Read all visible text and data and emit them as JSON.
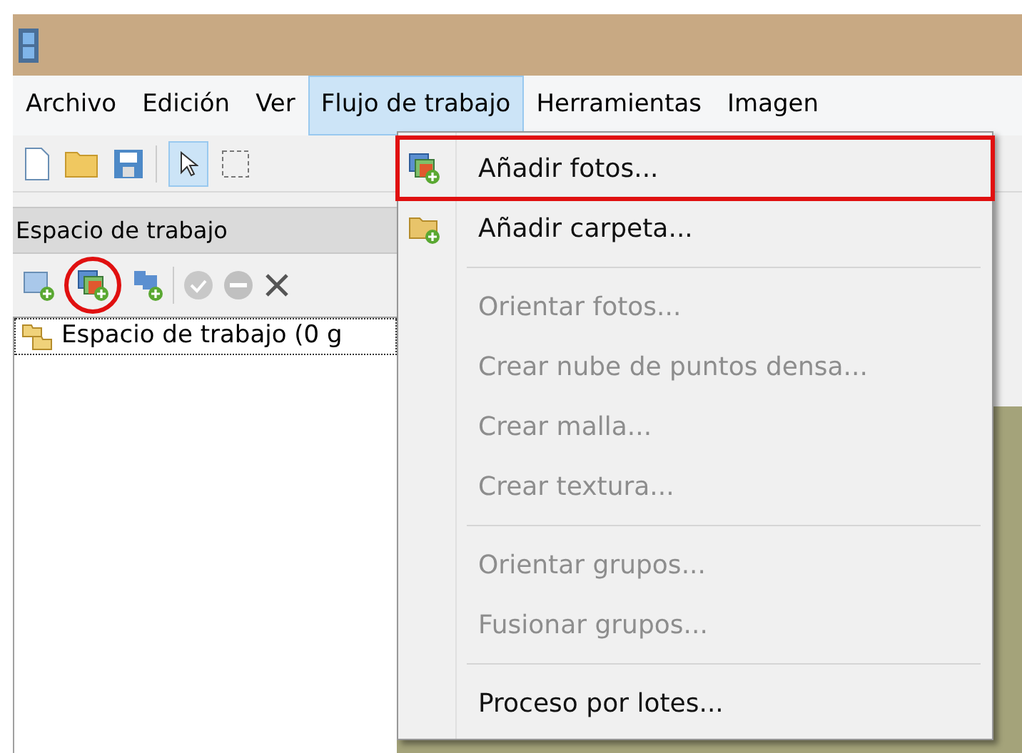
{
  "menu_bar": [
    {
      "label": "Archivo",
      "selected": false
    },
    {
      "label": "Edición",
      "selected": false
    },
    {
      "label": "Ver",
      "selected": false
    },
    {
      "label": "Flujo de trabajo",
      "selected": true
    },
    {
      "label": "Herramientas",
      "selected": false
    },
    {
      "label": "Imagen",
      "selected": false
    }
  ],
  "workspace_panel": {
    "title": "Espacio de trabajo",
    "tree": [
      {
        "label": "Espacio de trabajo (0 g"
      }
    ],
    "tools": [
      {
        "annotated": false
      },
      {
        "annotated": true
      },
      {
        "annotated": false
      }
    ]
  },
  "dropdown_menu": [
    {
      "kind": "item",
      "label": "Añadir fotos...",
      "disabled": false,
      "annotated": true
    },
    {
      "kind": "item",
      "label": "Añadir carpeta...",
      "disabled": false,
      "annotated": false
    },
    {
      "kind": "separator"
    },
    {
      "kind": "item",
      "label": "Orientar fotos...",
      "disabled": true,
      "annotated": false
    },
    {
      "kind": "item",
      "label": "Crear nube de puntos densa...",
      "disabled": true,
      "annotated": false
    },
    {
      "kind": "item",
      "label": "Crear malla...",
      "disabled": true,
      "annotated": false
    },
    {
      "kind": "item",
      "label": "Crear textura...",
      "disabled": true,
      "annotated": false
    },
    {
      "kind": "separator"
    },
    {
      "kind": "item",
      "label": "Orientar grupos...",
      "disabled": true,
      "annotated": false
    },
    {
      "kind": "item",
      "label": "Fusionar grupos...",
      "disabled": true,
      "annotated": false
    },
    {
      "kind": "separator"
    },
    {
      "kind": "item",
      "label": "Proceso por lotes...",
      "disabled": false,
      "annotated": false
    }
  ]
}
